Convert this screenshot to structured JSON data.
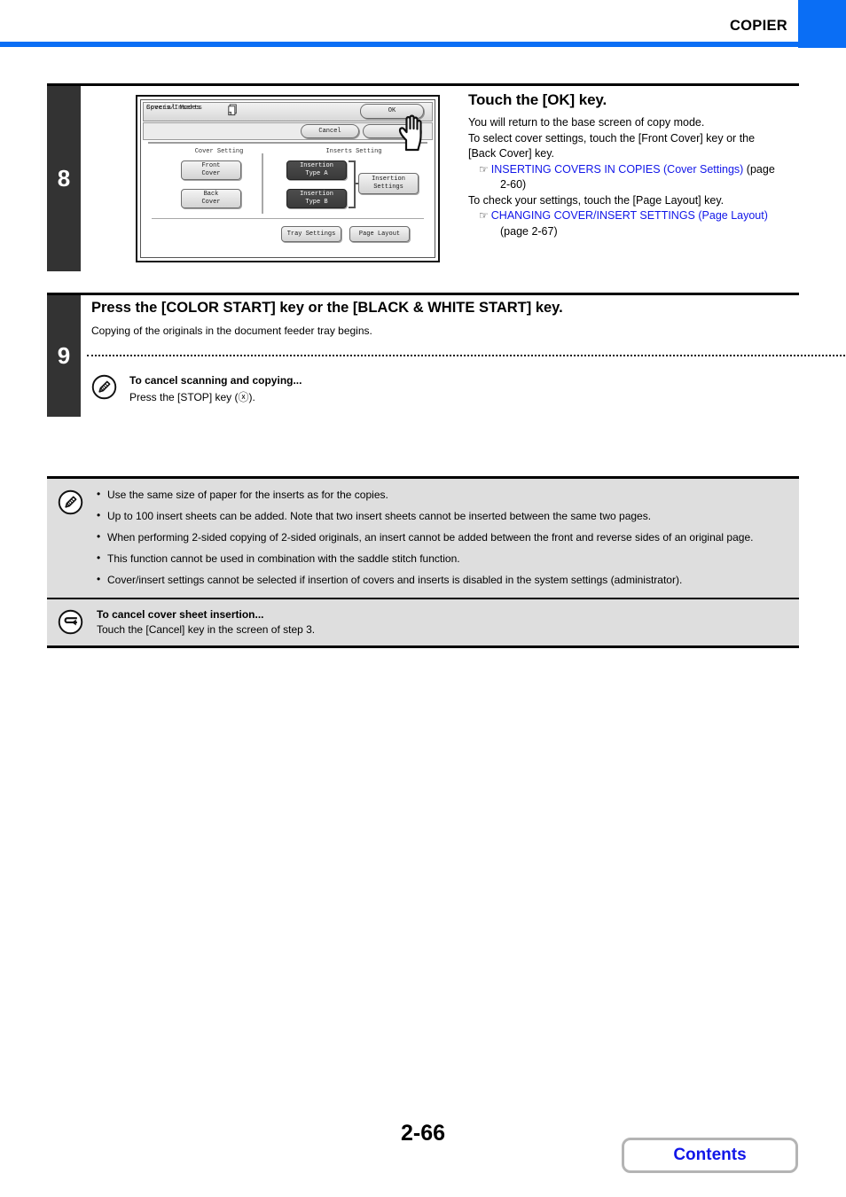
{
  "header": {
    "title": "COPIER",
    "accent_color": "#0a6ef5"
  },
  "steps": [
    {
      "number": "8",
      "heading": "Touch the [OK] key.",
      "lines": [
        "You will return to the base screen of copy mode.",
        "To select cover settings, touch the [Front Cover] key or the",
        "[Back Cover] key."
      ],
      "refs": [
        {
          "marker": "☞",
          "link": "INSERTING COVERS IN COPIES (Cover Settings)",
          "suffix": " (page",
          "continuation": "2-60)"
        },
        {
          "marker": "☞",
          "link": "CHANGING COVER/INSERT SETTINGS (Page Layout)",
          "suffix": "",
          "continuation": "(page 2-67)"
        }
      ],
      "mid_line": "To check your settings, touch the [Page Layout] key."
    },
    {
      "number": "9",
      "heading": "Press the [COLOR START] key or the [BLACK & WHITE START] key.",
      "sub": "Copying of the originals in the document feeder tray begins.",
      "note": {
        "icon": "pencil-note-icon",
        "title": "To cancel scanning and copying...",
        "body_before": "Press the [STOP] key (",
        "body_glyph": "ⓧ",
        "body_after": ")."
      }
    }
  ],
  "lcd": {
    "title": "Special Modes",
    "title_icon": "pages-stack-icon",
    "subtitle": "Covers/Inserts",
    "ok_label": "OK",
    "cancel_label": "Cancel",
    "hidden_label": "",
    "cover_setting_label": "Cover Setting",
    "inserts_setting_label": "Inserts Setting",
    "buttons": {
      "front_cover": "Front\nCover",
      "front_cover_l1": "Front",
      "front_cover_l2": "Cover",
      "back_cover_l1": "Back",
      "back_cover_l2": "Cover",
      "insertion_a_l1": "Insertion",
      "insertion_a_l2": "Type A",
      "insertion_b_l1": "Insertion",
      "insertion_b_l2": "Type B",
      "insertion_settings_l1": "Insertion",
      "insertion_settings_l2": "Settings",
      "tray_settings": "Tray Settings",
      "page_layout": "Page Layout"
    },
    "cursor": "pointing-hand-cursor"
  },
  "notebox": {
    "icon": "pencil-note-icon",
    "bullets": [
      "Use the same size of paper for the inserts as for the copies.",
      "Up to 100 insert sheets can be added. Note that two insert sheets cannot be inserted between the same two pages.",
      "When performing 2-sided copying of 2-sided originals, an insert cannot be added between the front and reverse sides of an original page.",
      "This function cannot be used in combination with the saddle stitch function.",
      "Cover/insert settings cannot be selected if insertion of covers and inserts is disabled in the system settings (administrator)."
    ],
    "cancel_note": {
      "icon": "return-arrow-icon",
      "title": "To cancel cover sheet insertion...",
      "body": "Touch the [Cancel] key in the screen of step 3."
    }
  },
  "footer": {
    "page_number": "2-66",
    "contents_label": "Contents",
    "link_color": "#1116e8"
  }
}
